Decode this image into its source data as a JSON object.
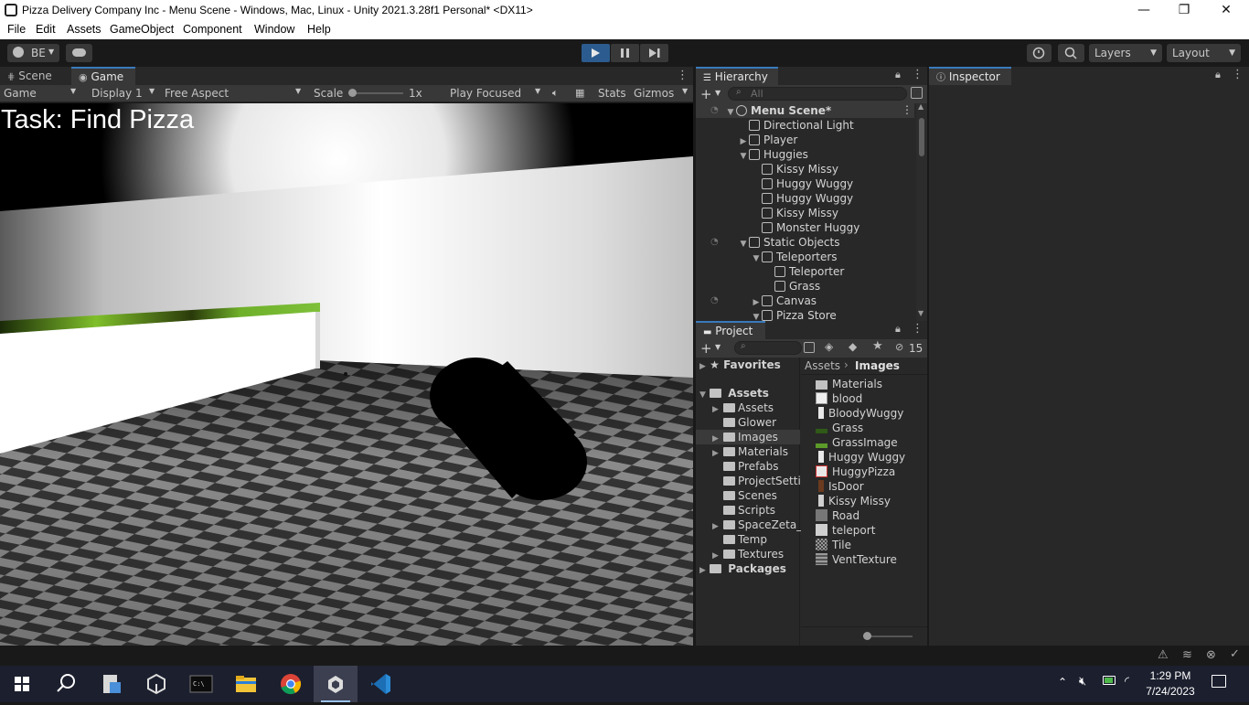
{
  "window": {
    "title": "Pizza Delivery Company Inc - Menu Scene - Windows, Mac, Linux - Unity 2021.3.28f1 Personal* <DX11>",
    "minimize_glyph": "—",
    "maximize_glyph": "❐",
    "close_glyph": "✕"
  },
  "menu": [
    "File",
    "Edit",
    "Assets",
    "GameObject",
    "Component",
    "Window",
    "Help"
  ],
  "toolbar": {
    "account_label": "BE",
    "layers_label": "Layers",
    "layout_label": "Layout",
    "play_color": "#2c5c8f"
  },
  "scene_game_tabs": [
    "Scene",
    "Game"
  ],
  "game_toolbar": {
    "mode": "Game",
    "display": "Display 1",
    "aspect": "Free Aspect",
    "scale_label": "Scale",
    "scale_value": "1x",
    "play_mode": "Play Focused",
    "stats": "Stats",
    "gizmos": "Gizmos"
  },
  "game_overlay": {
    "task_text": "Task: Find Pizza"
  },
  "hierarchy": {
    "tab": "Hierarchy",
    "search_placeholder": "All",
    "rows": [
      {
        "label": "Menu Scene*",
        "indent": 0,
        "arrow": "▼",
        "scene": true
      },
      {
        "label": "Directional Light",
        "indent": 1,
        "arrow": ""
      },
      {
        "label": "Player",
        "indent": 1,
        "arrow": "▶"
      },
      {
        "label": "Huggies",
        "indent": 1,
        "arrow": "▼"
      },
      {
        "label": "Kissy Missy",
        "indent": 2,
        "arrow": ""
      },
      {
        "label": "Huggy Wuggy",
        "indent": 2,
        "arrow": ""
      },
      {
        "label": "Huggy Wuggy",
        "indent": 2,
        "arrow": ""
      },
      {
        "label": "Kissy Missy",
        "indent": 2,
        "arrow": ""
      },
      {
        "label": "Monster Huggy",
        "indent": 2,
        "arrow": ""
      },
      {
        "label": "Static Objects",
        "indent": 1,
        "arrow": "▼"
      },
      {
        "label": "Teleporters",
        "indent": 2,
        "arrow": "▼"
      },
      {
        "label": "Teleporter",
        "indent": 3,
        "arrow": ""
      },
      {
        "label": "Grass",
        "indent": 3,
        "arrow": ""
      },
      {
        "label": "Canvas",
        "indent": 2,
        "arrow": "▶"
      },
      {
        "label": "Pizza Store",
        "indent": 2,
        "arrow": "▼"
      }
    ]
  },
  "project": {
    "tab": "Project",
    "hidden_count": "15",
    "favorites": "Favorites",
    "assets_root": "Assets",
    "folders": [
      {
        "label": "Assets",
        "arrow": "▶"
      },
      {
        "label": "Glower",
        "arrow": ""
      },
      {
        "label": "Images",
        "arrow": "▶",
        "selected": true
      },
      {
        "label": "Materials",
        "arrow": "▶"
      },
      {
        "label": "Prefabs",
        "arrow": ""
      },
      {
        "label": "ProjectSetti",
        "arrow": ""
      },
      {
        "label": "Scenes",
        "arrow": ""
      },
      {
        "label": "Scripts",
        "arrow": ""
      },
      {
        "label": "SpaceZeta_",
        "arrow": "▶"
      },
      {
        "label": "Temp",
        "arrow": ""
      },
      {
        "label": "Textures",
        "arrow": "▶"
      }
    ],
    "packages": "Packages",
    "breadcrumb": [
      "Assets",
      "Images"
    ],
    "files": [
      {
        "label": "Materials",
        "kind": "folder"
      },
      {
        "label": "blood",
        "kind": "red"
      },
      {
        "label": "BloodyWuggy",
        "kind": "tall"
      },
      {
        "label": "Grass",
        "kind": "green-dark"
      },
      {
        "label": "GrassImage",
        "kind": "green"
      },
      {
        "label": "Huggy Wuggy",
        "kind": "tall"
      },
      {
        "label": "HuggyPizza",
        "kind": "pizza"
      },
      {
        "label": "IsDoor",
        "kind": "door"
      },
      {
        "label": "Kissy Missy",
        "kind": "tall-light"
      },
      {
        "label": "Road",
        "kind": "gray"
      },
      {
        "label": "teleport",
        "kind": "light"
      },
      {
        "label": "Tile",
        "kind": "checker"
      },
      {
        "label": "VentTexture",
        "kind": "stripes"
      }
    ]
  },
  "inspector": {
    "tab": "Inspector"
  },
  "taskbar": {
    "time": "1:29 PM",
    "date": "7/24/2023"
  }
}
